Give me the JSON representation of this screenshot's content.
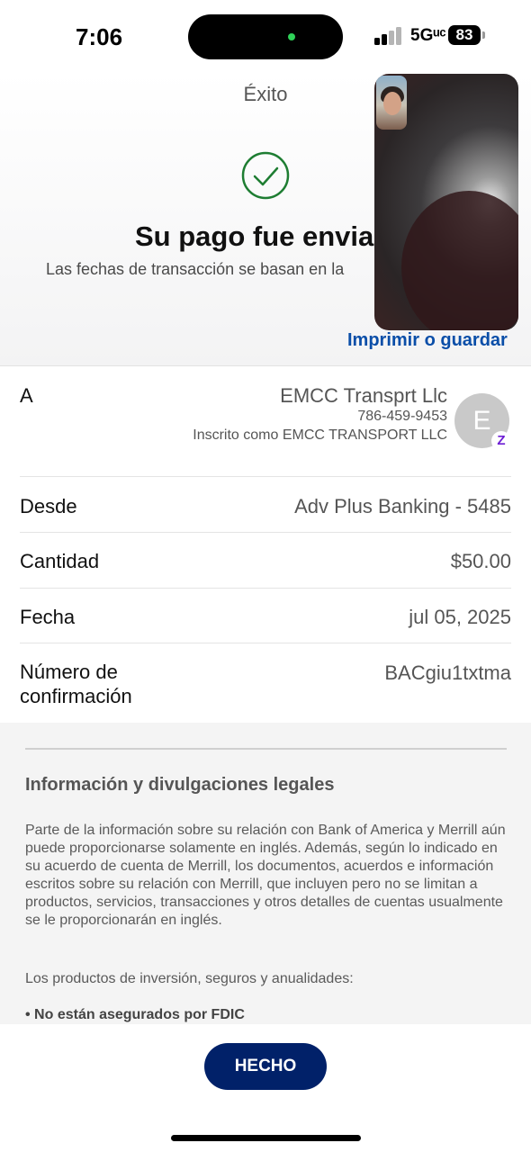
{
  "status_bar": {
    "time": "7:06",
    "network": "5Gᵘᶜ",
    "battery": "83"
  },
  "header": {
    "title": "Éxito",
    "success_title": "Su pago fue enviad",
    "success_subtitle": "Las fechas de transacción se basan en la",
    "print_link": "Imprimir o guardar"
  },
  "recipient": {
    "label": "A",
    "name": "EMCC Transprt Llc",
    "phone": "786-459-9453",
    "registered_as": "Inscrito como EMCC TRANSPORT LLC",
    "avatar_initial": "E",
    "badge_icon": "zelle-icon",
    "badge_glyph": "Z"
  },
  "details": [
    {
      "label": "Desde",
      "value": "Adv Plus Banking - 5485"
    },
    {
      "label": "Cantidad",
      "value": "$50.00"
    },
    {
      "label": "Fecha",
      "value": "jul 05, 2025"
    },
    {
      "label": "Número de confirmación",
      "value": "BACgiu1txtma"
    }
  ],
  "legal": {
    "title": "Información y divulgaciones legales",
    "body": "Parte de la información sobre su relación con Bank of America y Merrill aún puede proporcionarse solamente en inglés. Además, según lo indicado en su acuerdo de cuenta de Merrill, los documentos, acuerdos e información escritos sobre su relación con Merrill, que incluyen pero no se limitan a productos, servicios, transacciones y otros detalles de cuentas usualmente se le proporcionarán en inglés.",
    "products_intro": "Los productos de inversión, seguros y anualidades:",
    "bullet": "• No están asegurados por FDIC"
  },
  "actions": {
    "done_label": "HECHO"
  },
  "colors": {
    "primary_navy": "#012169",
    "link_blue": "#0a4ea8",
    "success_green": "#1e7d32",
    "zelle_purple": "#6d1ed4"
  }
}
